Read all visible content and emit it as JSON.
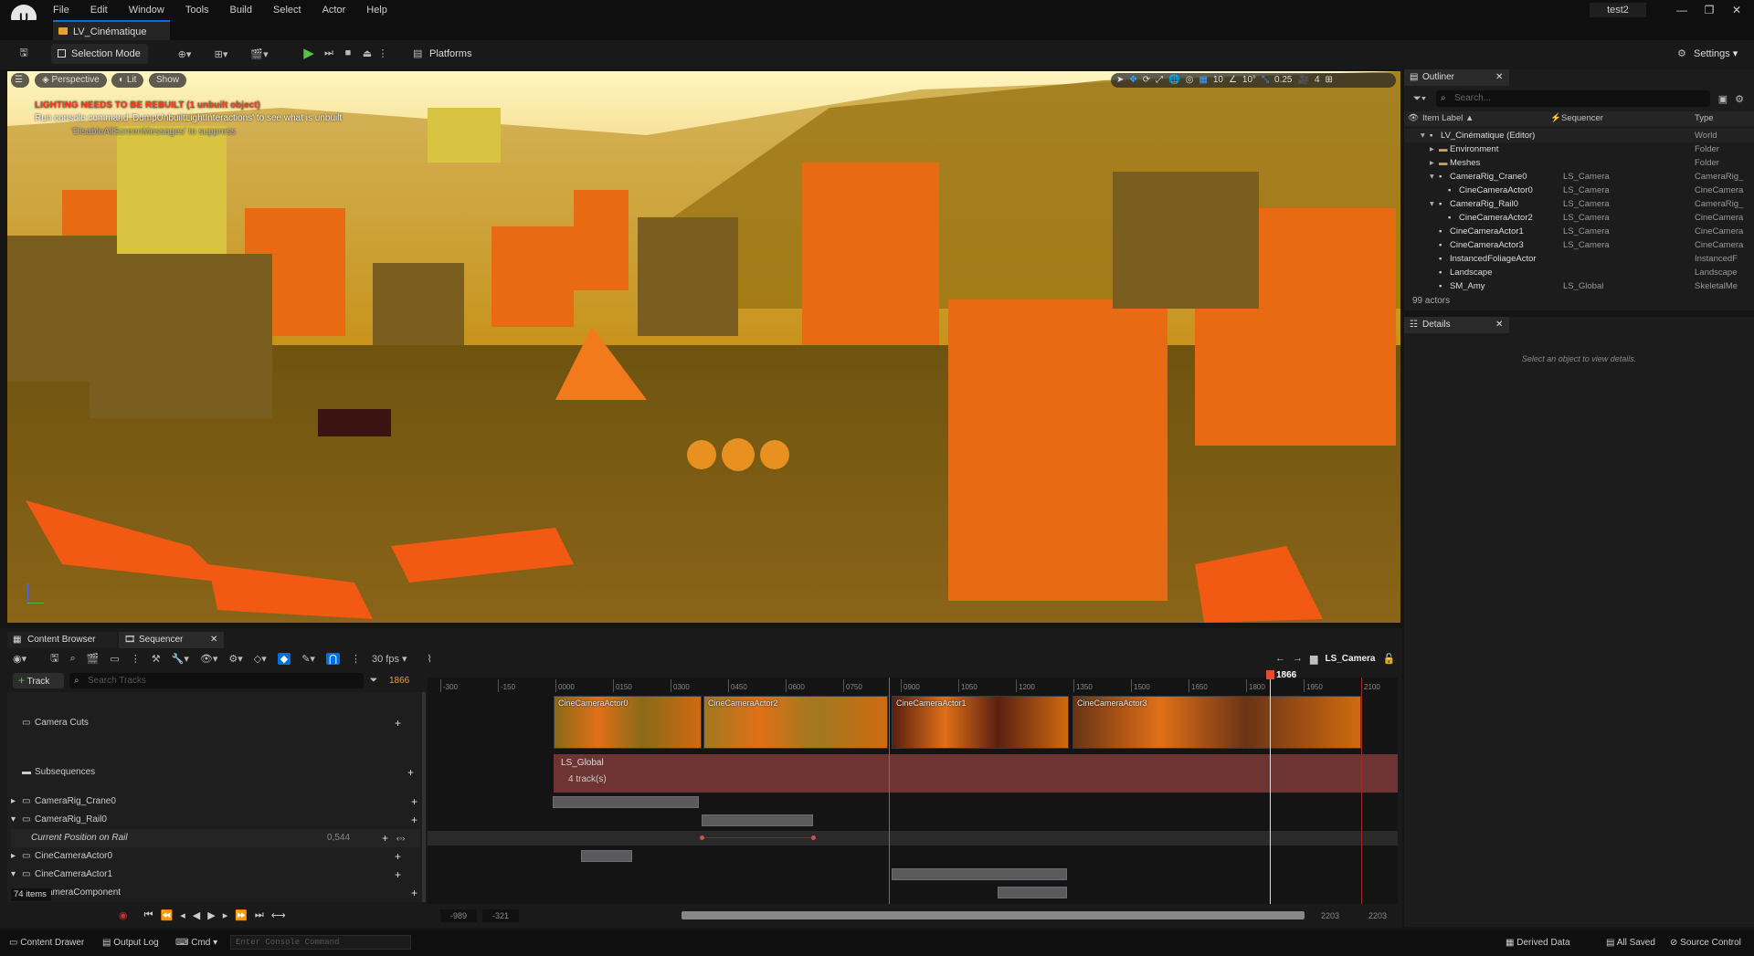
{
  "app": {
    "logo_text": "U",
    "menu": [
      "File",
      "Edit",
      "Window",
      "Tools",
      "Build",
      "Select",
      "Actor",
      "Help"
    ],
    "project": "test2",
    "level_tab": "LV_Cinématique"
  },
  "toolbar": {
    "selection_mode": "Selection Mode",
    "platforms": "Platforms",
    "settings": "Settings"
  },
  "viewport": {
    "perspective": "Perspective",
    "lit": "Lit",
    "show": "Show",
    "warning_line1": "LIGHTING NEEDS TO BE REBUILT (1 unbuilt object)",
    "warning_line2": "Run console command 'DumpUnbuiltLightInteractions' to see what is unbuilt",
    "warning_line3": "'DisableAllScreenMessages' to suppress",
    "grid_snap": "10",
    "rot_snap": "10°",
    "scale_snap": "0.25",
    "camera_speed": "4"
  },
  "outliner": {
    "tab": "Outliner",
    "search_placeholder": "Search...",
    "col_label": "Item Label ▲",
    "col_seq": "Sequencer",
    "col_type": "Type",
    "rows": [
      {
        "label": "LV_Cinématique (Editor)",
        "seq": "",
        "type": "World",
        "indent": 0
      },
      {
        "label": "Environment",
        "seq": "",
        "type": "Folder",
        "indent": 1
      },
      {
        "label": "Meshes",
        "seq": "",
        "type": "Folder",
        "indent": 1
      },
      {
        "label": "CameraRig_Crane0",
        "seq": "LS_Camera",
        "type": "CameraRig_",
        "indent": 1
      },
      {
        "label": "CineCameraActor0",
        "seq": "LS_Camera",
        "type": "CineCamera",
        "indent": 2
      },
      {
        "label": "CameraRig_Rail0",
        "seq": "LS_Camera",
        "type": "CameraRig_",
        "indent": 1
      },
      {
        "label": "CineCameraActor2",
        "seq": "LS_Camera",
        "type": "CineCamera",
        "indent": 2
      },
      {
        "label": "CineCameraActor1",
        "seq": "LS_Camera",
        "type": "CineCamera",
        "indent": 1
      },
      {
        "label": "CineCameraActor3",
        "seq": "LS_Camera",
        "type": "CineCamera",
        "indent": 1
      },
      {
        "label": "InstancedFoliageActor",
        "seq": "",
        "type": "InstancedF",
        "indent": 1
      },
      {
        "label": "Landscape",
        "seq": "",
        "type": "Landscape",
        "indent": 1
      },
      {
        "label": "SM_Amy",
        "seq": "LS_Global",
        "type": "SkeletalMe",
        "indent": 1
      }
    ],
    "count": "99 actors"
  },
  "details": {
    "tab": "Details",
    "empty": "Select an object to view details."
  },
  "sequencer": {
    "tab_content": "Content Browser",
    "tab_seq": "Sequencer",
    "fps": "30 fps",
    "seq_name": "LS_Camera",
    "add_track": "Track",
    "search_placeholder": "Search Tracks",
    "frame": "1866",
    "playhead_label": "1866",
    "tracks": [
      {
        "label": "Camera Cuts"
      },
      {
        "label": "Subsequences"
      },
      {
        "label": "CameraRig_Crane0"
      },
      {
        "label": "CameraRig_Rail0"
      },
      {
        "label": "Current Position on Rail",
        "value": "0,544"
      },
      {
        "label": "CineCameraActor0"
      },
      {
        "label": "CineCameraActor1"
      },
      {
        "label": "ameraComponent"
      }
    ],
    "items_count": "74 items",
    "ticks": [
      "-300",
      "-150",
      "0000",
      "0150",
      "0300",
      "0450",
      "0600",
      "0750",
      "0900",
      "1050",
      "1200",
      "1350",
      "1500",
      "1650",
      "1800",
      "1950",
      "2100"
    ],
    "clips": [
      "CineCameraActor0",
      "CineCameraActor2",
      "CineCameraActor1",
      "CineCameraActor3"
    ],
    "subseq_name": "LS_Global",
    "subseq_tracks": "4 track(s)",
    "range_start1": "-989",
    "range_start2": "-321",
    "range_end1": "2203",
    "range_end2": "2203"
  },
  "bottom": {
    "content_drawer": "Content Drawer",
    "output_log": "Output Log",
    "cmd": "Cmd",
    "console_placeholder": "Enter Console Command",
    "derived": "Derived Data",
    "saved": "All Saved",
    "source": "Source Control"
  }
}
